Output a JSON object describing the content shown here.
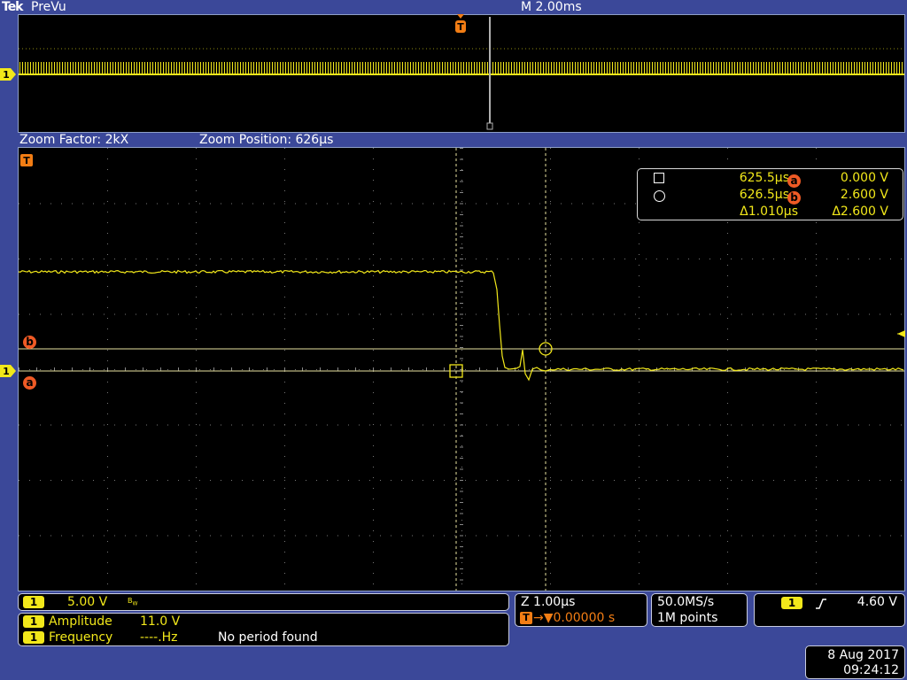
{
  "header": {
    "brand": "Tek",
    "mode": "PreVu",
    "timebase": "M 2.00ms"
  },
  "overview": {
    "trigger_marker": "T",
    "channel_marker": "1"
  },
  "zoom": {
    "factor": "Zoom Factor: 2kX",
    "position": "Zoom Position: 626µs"
  },
  "main": {
    "trigger_marker": "T",
    "channel_marker": "1",
    "cursor_a_marker": "a",
    "cursor_b_marker": "b"
  },
  "cursor_readout": {
    "cursor1_time": "625.5µs",
    "cursor2_time": "626.5µs",
    "delta_time": "Δ1.010µs",
    "a_label": "a",
    "a_value": "0.000 V",
    "b_label": "b",
    "b_value": "2.600 V",
    "delta_volts": "Δ2.600 V"
  },
  "channel_panel": {
    "channel": "1",
    "scale": "5.00 V",
    "bw_icon": "bandwidth-limit-icon"
  },
  "measurements": [
    {
      "channel": "1",
      "name": "Amplitude",
      "value": "11.0 V",
      "note": ""
    },
    {
      "channel": "1",
      "name": "Frequency",
      "value": "----.Hz",
      "note": "No period found"
    }
  ],
  "zoom_panel": {
    "zoom_scale": "Z 1.00µs",
    "trigger_badge": "T",
    "trigger_offset": "→▼0.00000 s"
  },
  "acq_panel": {
    "rate": "50.0MS/s",
    "points": "1M points"
  },
  "trigger_panel": {
    "channel": "1",
    "slope_icon": "rising-edge-icon",
    "level": "4.60 V"
  },
  "datetime": {
    "date": "8 Aug 2017",
    "time": "09:24:12"
  },
  "colors": {
    "background": "#3b4899",
    "trace": "#f2e81a",
    "cursor_badge": "#ef5a25",
    "trigger_marker": "#f27d14"
  }
}
